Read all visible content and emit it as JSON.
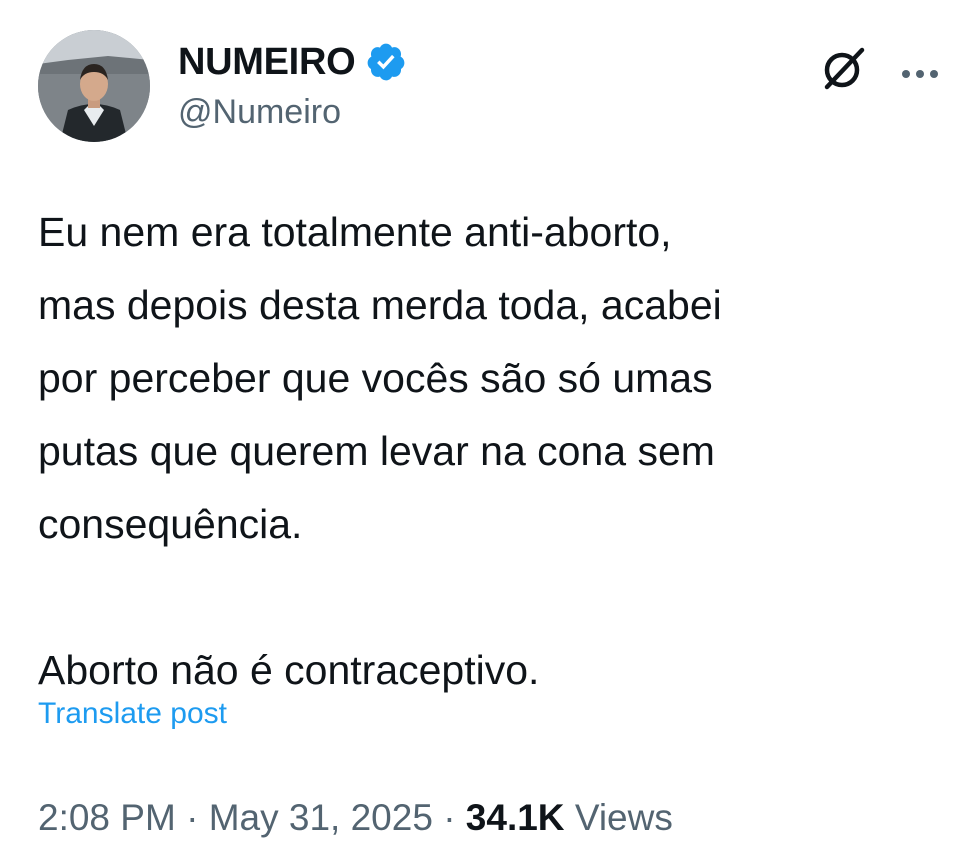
{
  "author": {
    "display_name": "NUMEIRO",
    "handle": "@Numeiro",
    "verified_icon": "verified-badge-icon",
    "verified_color": "#1d9bf0"
  },
  "actions": {
    "grok_icon": "grok-icon",
    "more_icon": "more-options-icon"
  },
  "post": {
    "paragraph_1": "Eu nem era totalmente anti-aborto,\nmas depois desta merda toda, acabei\npor perceber que vocês são só umas\nputas que querem levar na cona sem\nconsequência.",
    "paragraph_2": "Aborto não é contraceptivo.",
    "translate_label": "Translate post"
  },
  "meta": {
    "time": "2:08 PM",
    "separator": "·",
    "date": "May 31, 2025",
    "views_count": "34.1K",
    "views_label": "Views"
  },
  "colors": {
    "text": "#0f1419",
    "secondary": "#536471",
    "link": "#1d9bf0"
  }
}
